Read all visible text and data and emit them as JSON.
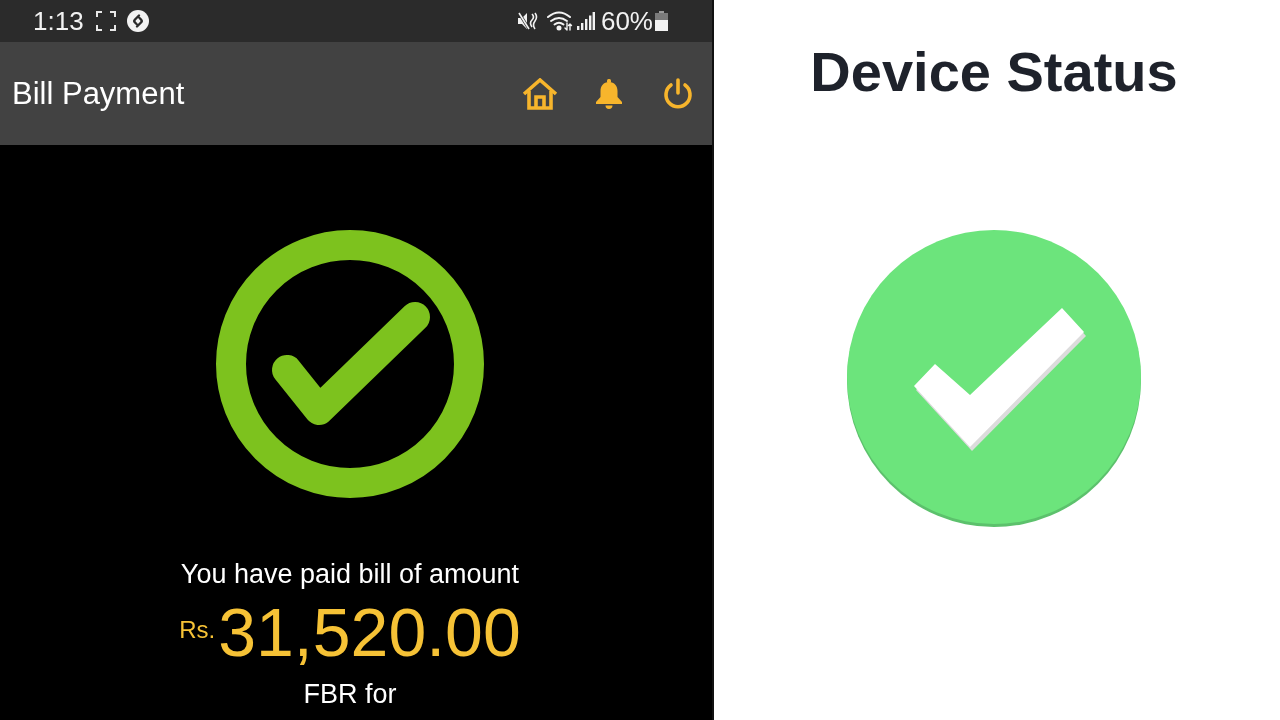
{
  "status_bar": {
    "time": "1:13",
    "battery": "60%"
  },
  "app_bar": {
    "title": "Bill Payment"
  },
  "payment": {
    "message": "You have paid bill of amount",
    "currency": "Rs.",
    "amount": "31,520.00",
    "recipient": "FBR for"
  },
  "device_status": {
    "title": "Device Status"
  }
}
